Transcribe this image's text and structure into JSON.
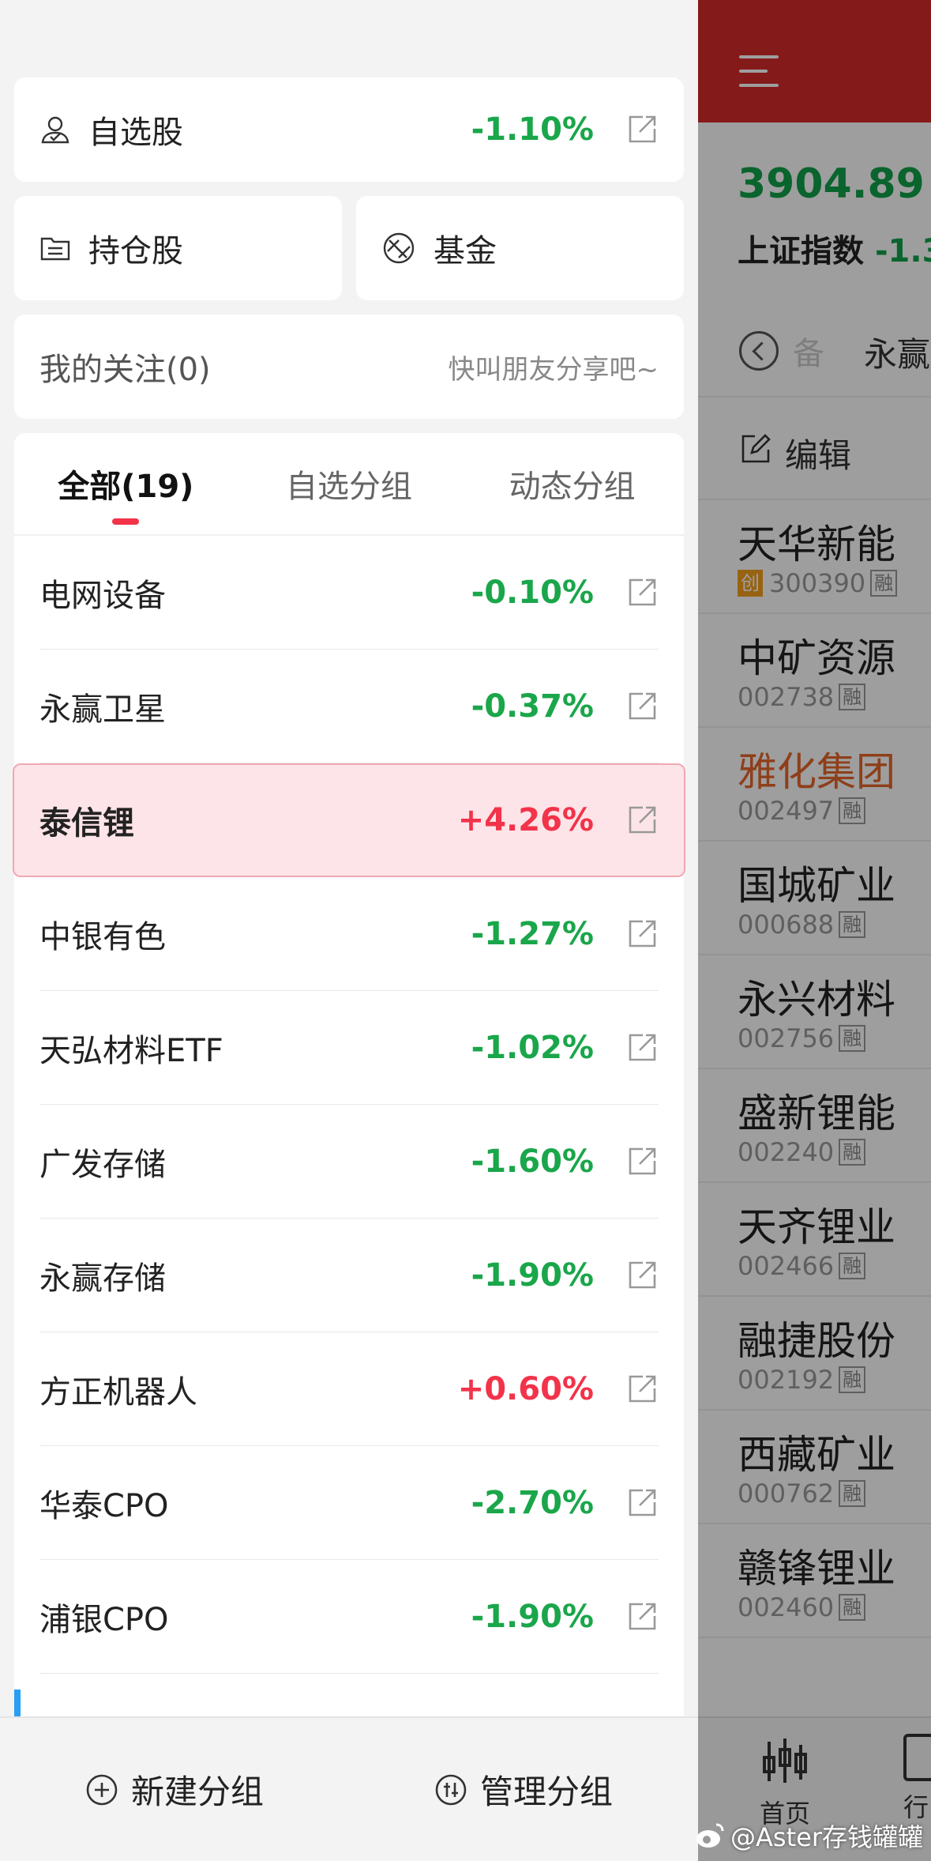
{
  "drawer": {
    "watchlist": {
      "label": "自选股",
      "change": "-1.10%"
    },
    "holdings": {
      "label": "持仓股"
    },
    "funds": {
      "label": "基金"
    },
    "follow": {
      "title": "我的关注(0)",
      "hint": "快叫朋友分享吧~"
    },
    "tabs": [
      {
        "label": "全部(19)",
        "active": true
      },
      {
        "label": "自选分组",
        "active": false
      },
      {
        "label": "动态分组",
        "active": false
      }
    ],
    "groups": [
      {
        "name": "电网设备",
        "change": "-0.10%",
        "dir": "down"
      },
      {
        "name": "永赢卫星",
        "change": "-0.37%",
        "dir": "down"
      },
      {
        "name": "泰信锂",
        "change": "+4.26%",
        "dir": "up",
        "highlight": true
      },
      {
        "name": "中银有色",
        "change": "-1.27%",
        "dir": "down"
      },
      {
        "name": "天弘材料ETF",
        "change": "-1.02%",
        "dir": "down"
      },
      {
        "name": "广发存储",
        "change": "-1.60%",
        "dir": "down"
      },
      {
        "name": "永赢存储",
        "change": "-1.90%",
        "dir": "down"
      },
      {
        "name": "方正机器人",
        "change": "+0.60%",
        "dir": "up"
      },
      {
        "name": "华泰CPO",
        "change": "-2.70%",
        "dir": "down"
      },
      {
        "name": "浦银CPO",
        "change": "-1.90%",
        "dir": "down"
      }
    ],
    "bottom": {
      "new_group": "新建分组",
      "manage_group": "管理分组"
    }
  },
  "app": {
    "index_value": "3904.89 -",
    "index_name": "上证指数",
    "index_change": "-1.3",
    "ghost_tab": "备",
    "tab_name": "永赢",
    "edit_label": "编辑",
    "stocks": [
      {
        "name": "天华新能",
        "code": "300390",
        "chuang": true,
        "orange": false
      },
      {
        "name": "中矿资源",
        "code": "002738",
        "chuang": false,
        "orange": false
      },
      {
        "name": "雅化集团",
        "code": "002497",
        "chuang": false,
        "orange": true
      },
      {
        "name": "国城矿业",
        "code": "000688",
        "chuang": false,
        "orange": false
      },
      {
        "name": "永兴材料",
        "code": "002756",
        "chuang": false,
        "orange": false
      },
      {
        "name": "盛新锂能",
        "code": "002240",
        "chuang": false,
        "orange": false
      },
      {
        "name": "天齐锂业",
        "code": "002466",
        "chuang": false,
        "orange": false
      },
      {
        "name": "融捷股份",
        "code": "002192",
        "chuang": false,
        "orange": false
      },
      {
        "name": "西藏矿业",
        "code": "000762",
        "chuang": false,
        "orange": false
      },
      {
        "name": "赣锋锂业",
        "code": "002460",
        "chuang": false,
        "orange": false
      }
    ],
    "badge_rong": "融",
    "badge_chuang": "创",
    "nav_home": "首页",
    "nav_second": "行"
  },
  "watermark": "@Aster存钱罐罐",
  "colors": {
    "down": "#1aa64a",
    "up": "#f2334a",
    "header": "#d72a2a"
  }
}
